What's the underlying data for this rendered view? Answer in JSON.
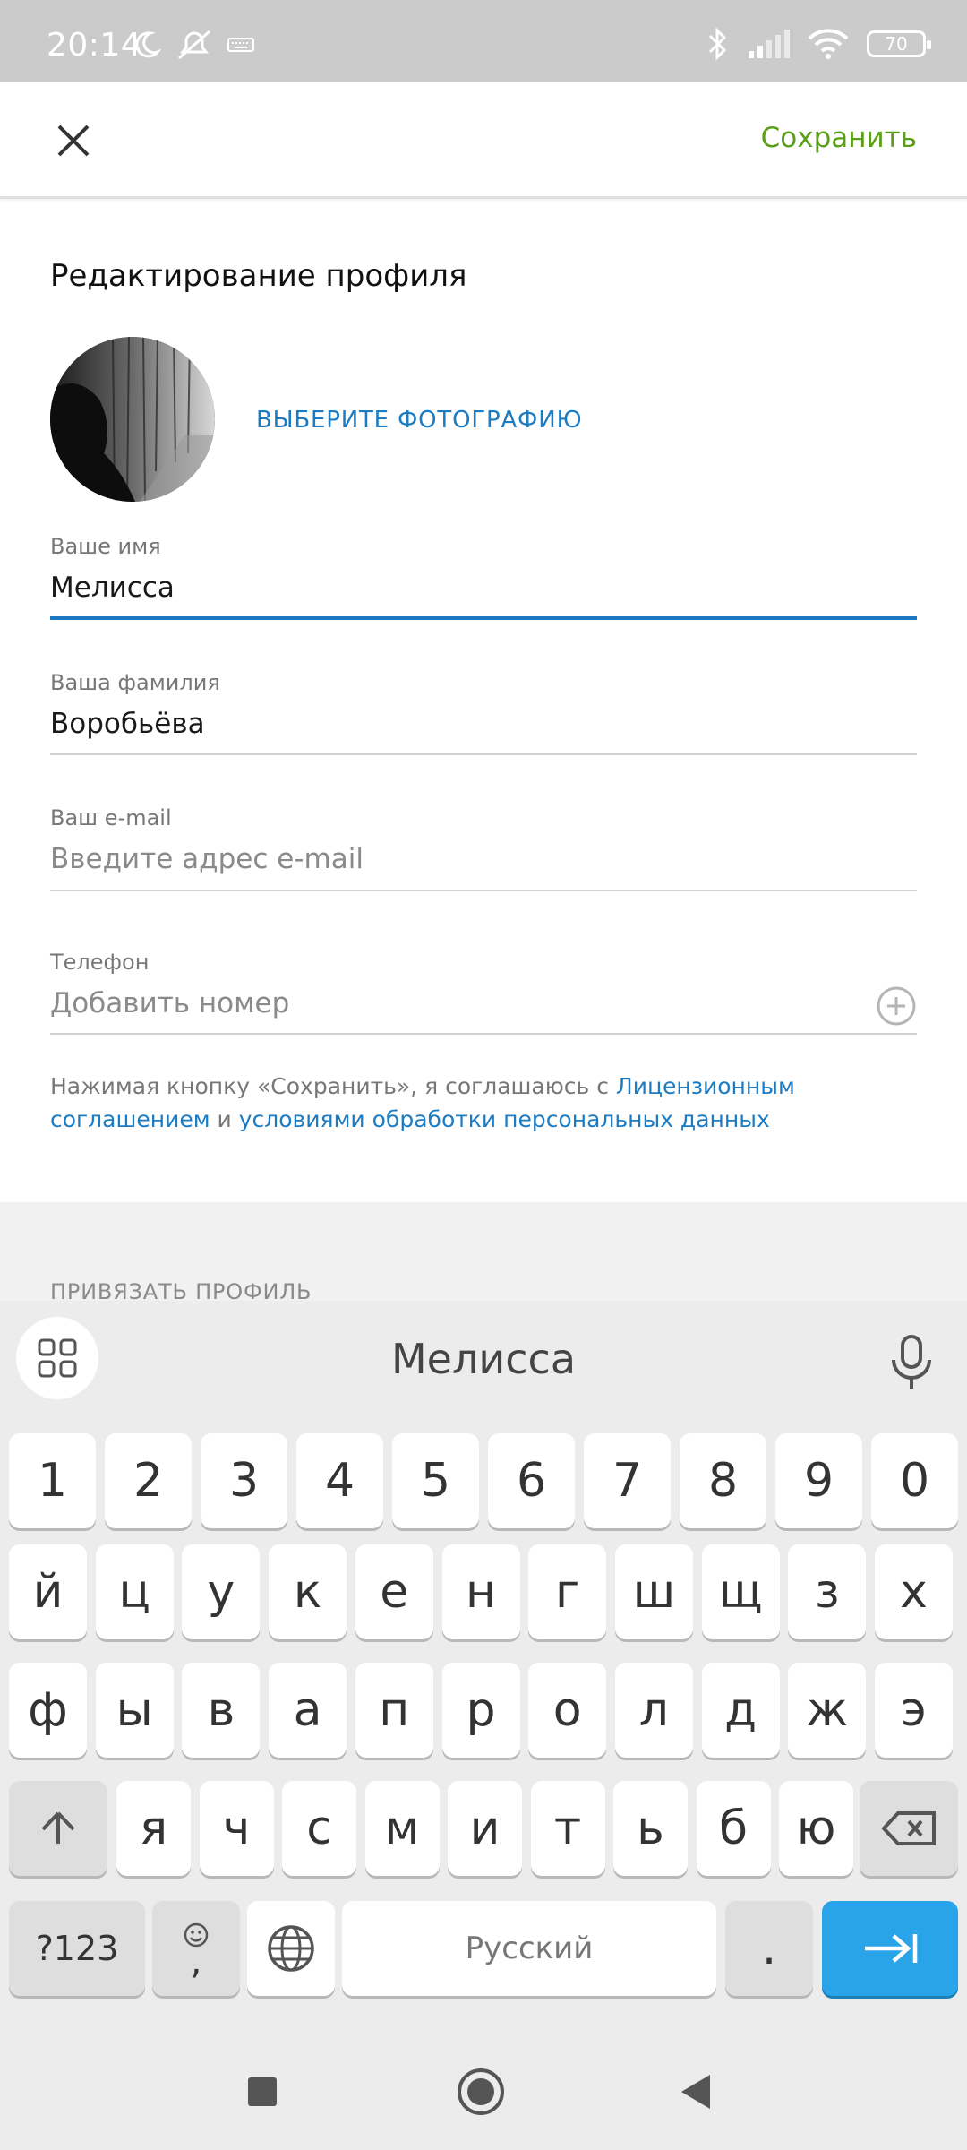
{
  "status_bar": {
    "time": "20:14",
    "battery": "70",
    "icons": [
      "moon-icon",
      "mute-icon",
      "keyboard-icon",
      "bluetooth-icon",
      "signal-icon",
      "wifi-icon",
      "battery-icon"
    ]
  },
  "app_bar": {
    "close_icon": "close-icon",
    "save_label": "Сохранить"
  },
  "profile": {
    "title": "Редактирование профиля",
    "choose_photo": "ВЫБЕРИТЕ ФОТОГРАФИЮ"
  },
  "fields": {
    "first_name": {
      "label": "Ваше имя",
      "value": "Мелисса"
    },
    "last_name": {
      "label": "Ваша фамилия",
      "value": "Воробьёва"
    },
    "email": {
      "label": "Ваш e-mail",
      "placeholder": "Введите адрес e-mail"
    },
    "phone": {
      "label": "Телефон",
      "placeholder": "Добавить номер"
    }
  },
  "consent": {
    "text_before": "Нажимая кнопку «Сохранить», я соглашаюсь с",
    "link_license": "Лицензионным соглашением",
    "text_and": "и",
    "link_privacy": "условиями обработки персональных данных"
  },
  "link_profile_header": "ПРИВЯЗАТЬ ПРОФИЛЬ",
  "keyboard": {
    "suggestion": "Мелисса",
    "row_numbers": [
      "1",
      "2",
      "3",
      "4",
      "5",
      "6",
      "7",
      "8",
      "9",
      "0"
    ],
    "row1": [
      "й",
      "ц",
      "у",
      "к",
      "е",
      "н",
      "г",
      "ш",
      "щ",
      "з",
      "х"
    ],
    "row2": [
      "ф",
      "ы",
      "в",
      "а",
      "п",
      "р",
      "о",
      "л",
      "д",
      "ж",
      "э"
    ],
    "row3": [
      "я",
      "ч",
      "с",
      "м",
      "и",
      "т",
      "ь",
      "б",
      "ю"
    ],
    "sym_label": "?123",
    "comma": ",",
    "space_label": "Русский",
    "period": "."
  },
  "colors": {
    "accent_green": "#5a9e1a",
    "link_blue": "#1b7cc4",
    "active_underline": "#1c76c0",
    "enter_key": "#2aa4e8"
  }
}
